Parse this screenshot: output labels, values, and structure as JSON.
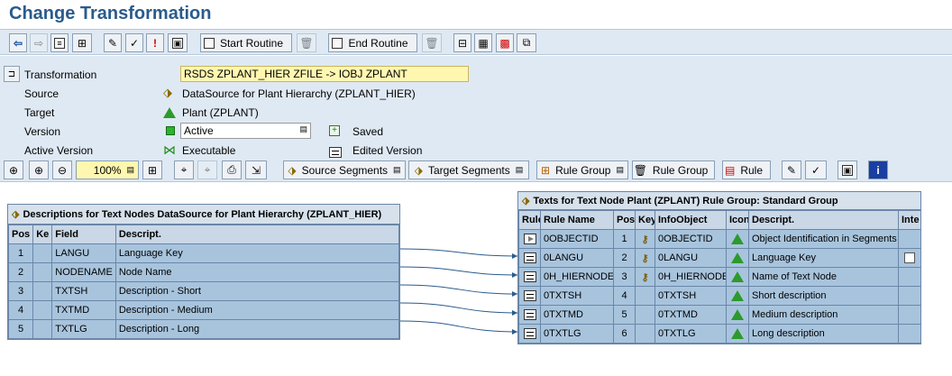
{
  "title": "Change Transformation",
  "toolbar": {
    "start_routine": "Start Routine",
    "end_routine": "End Routine"
  },
  "form": {
    "transformation_label": "Transformation",
    "transformation_value": "RSDS ZPLANT_HIER ZFILE -> IOBJ ZPLANT",
    "source_label": "Source",
    "source_value": "DataSource for Plant Hierarchy (ZPLANT_HIER)",
    "target_label": "Target",
    "target_value": "Plant (ZPLANT)",
    "version_label": "Version",
    "version_value": "Active",
    "saved_label": "Saved",
    "active_version_label": "Active Version",
    "active_version_value": "Executable",
    "edited_version_label": "Edited Version"
  },
  "toolbar2": {
    "zoom": "100%",
    "source_segments": "Source Segments",
    "target_segments": "Target Segments",
    "rule_group_dd": "Rule Group",
    "rule_group_del": "Rule Group",
    "rule": "Rule"
  },
  "source_table": {
    "title": "Descriptions for Text Nodes DataSource for Plant Hierarchy (ZPLANT_HIER)",
    "headers": [
      "Pos",
      "Ke",
      "Field",
      "Descript."
    ],
    "rows": [
      {
        "pos": "1",
        "field": "LANGU",
        "desc": "Language Key"
      },
      {
        "pos": "2",
        "field": "NODENAME",
        "desc": "Node Name"
      },
      {
        "pos": "3",
        "field": "TXTSH",
        "desc": "Description - Short"
      },
      {
        "pos": "4",
        "field": "TXTMD",
        "desc": "Description - Medium"
      },
      {
        "pos": "5",
        "field": "TXTLG",
        "desc": "Description - Long"
      }
    ]
  },
  "target_table": {
    "title": "Texts for Text Node Plant (ZPLANT) Rule Group: Standard Group",
    "headers": [
      "Rule",
      "Rule Name",
      "Pos",
      "Key",
      "InfoObject",
      "Icon",
      "Descript.",
      "Inte"
    ],
    "rows": [
      {
        "name": "0OBJECTID",
        "pos": "1",
        "key": true,
        "io": "0OBJECTID",
        "desc": "Object Identification in Segments",
        "play": true
      },
      {
        "name": "0LANGU",
        "pos": "2",
        "key": true,
        "io": "0LANGU",
        "desc": "Language Key",
        "chk": true
      },
      {
        "name": "0H_HIERNODE",
        "pos": "3",
        "key": true,
        "io": "0H_HIERNODE",
        "desc": "Name of Text Node"
      },
      {
        "name": "0TXTSH",
        "pos": "4",
        "key": false,
        "io": "0TXTSH",
        "desc": "Short description"
      },
      {
        "name": "0TXTMD",
        "pos": "5",
        "key": false,
        "io": "0TXTMD",
        "desc": "Medium description"
      },
      {
        "name": "0TXTLG",
        "pos": "6",
        "key": false,
        "io": "0TXTLG",
        "desc": "Long description"
      }
    ]
  }
}
